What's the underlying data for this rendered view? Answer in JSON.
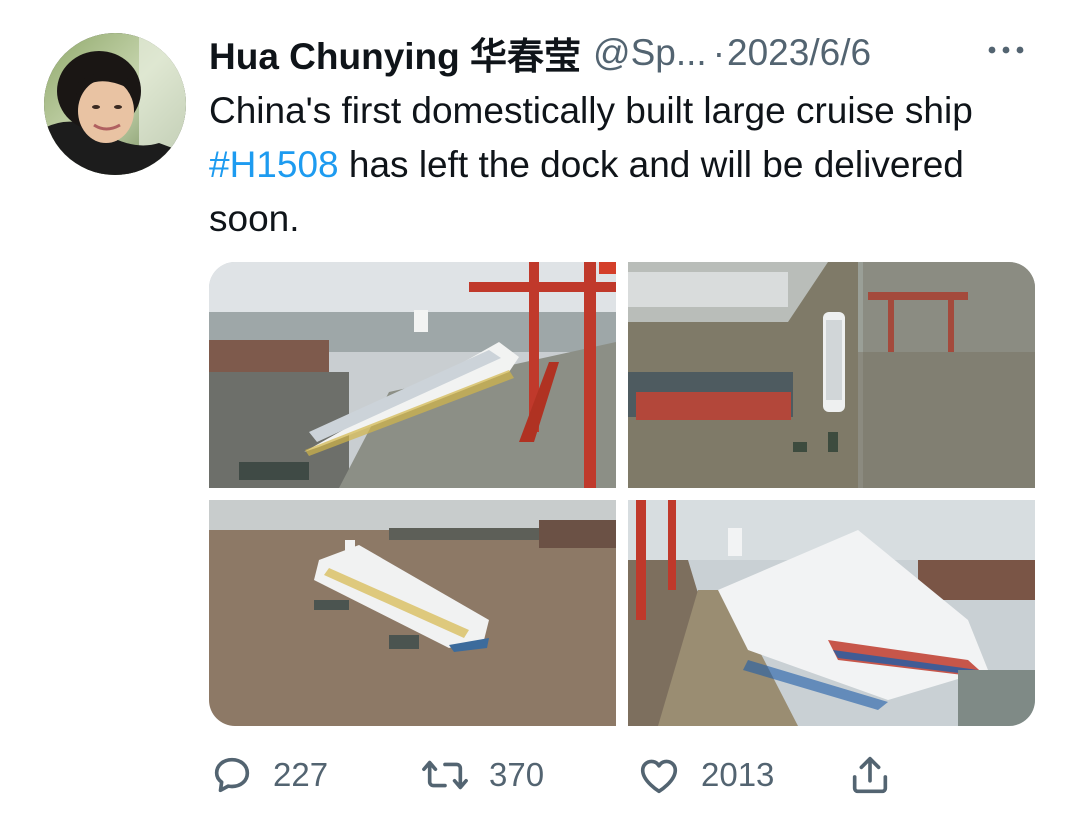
{
  "tweet": {
    "author_name": "Hua Chunying 华春莹",
    "handle": "@Sp...",
    "separator": "·",
    "date": "2023/6/6",
    "text_part1": "China's first domestically built large cruise ship ",
    "hashtag": "#H1508",
    "text_part2": " has left the dock and will be delivered soon."
  },
  "media": [
    {
      "id": "photo-1",
      "name": "cruise-ship-at-dock-photo"
    },
    {
      "id": "photo-2",
      "name": "shipyard-aerial-photo"
    },
    {
      "id": "photo-3",
      "name": "cruise-ship-on-river-photo"
    },
    {
      "id": "photo-4",
      "name": "cruise-ship-bow-close-photo"
    }
  ],
  "actions": {
    "reply_icon": "comment-bubble-icon",
    "reply_count": "227",
    "retweet_icon": "retweet-icon",
    "retweet_count": "370",
    "like_icon": "heart-icon",
    "like_count": "2013",
    "share_icon": "share-icon"
  },
  "colors": {
    "text": "#0f1419",
    "secondary": "#536471",
    "link": "#1d9bf0"
  }
}
